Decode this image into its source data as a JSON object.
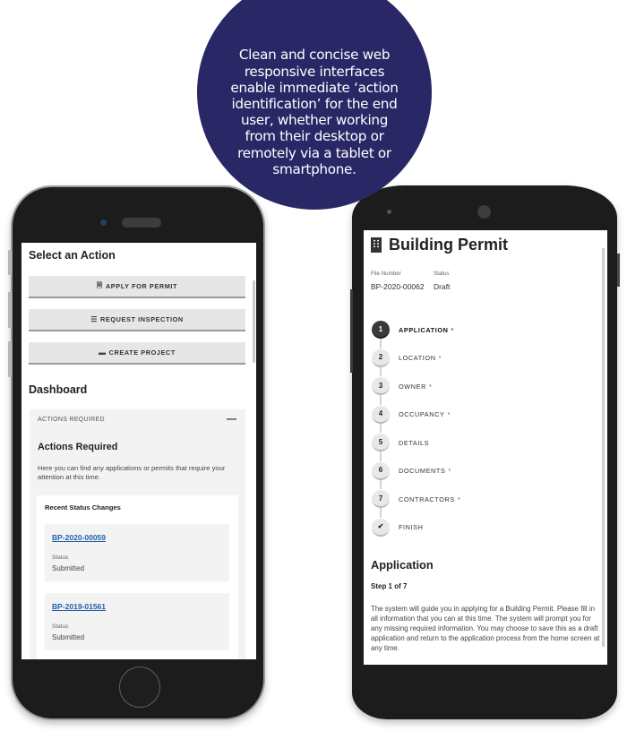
{
  "callout": {
    "text": "Clean and concise web responsive interfaces enable immediate ‘action identification’ for the end user, whether working from their desktop or remotely via a tablet or smartphone.",
    "background": "#2a2766"
  },
  "left_phone": {
    "select_action": {
      "title": "Select an Action",
      "buttons": [
        {
          "icon": "document-icon",
          "glyph": "🗎",
          "label": "APPLY FOR PERMIT"
        },
        {
          "icon": "checklist-icon",
          "glyph": "☰",
          "label": "REQUEST INSPECTION"
        },
        {
          "icon": "folder-icon",
          "glyph": "▬",
          "label": "CREATE PROJECT"
        }
      ]
    },
    "dashboard": {
      "title": "Dashboard",
      "panel": {
        "header": "ACTIONS REQUIRED",
        "collapse_glyph": "—",
        "title": "Actions Required",
        "description": "Here you can find any applications or permits that require your attention at this time.",
        "recent": {
          "title": "Recent Status Changes",
          "items": [
            {
              "file_number": "BP-2020-00059",
              "status_label": "Status",
              "status": "Submitted"
            },
            {
              "file_number": "BP-2019-01561",
              "status_label": "Status",
              "status": "Submitted"
            }
          ]
        }
      }
    },
    "link_color": "#1f5fa8"
  },
  "right_phone": {
    "title": "Building Permit",
    "file_number_label": "File Number",
    "file_number": "BP-2020-00062",
    "status_label": "Status",
    "status": "Draft",
    "steps": [
      {
        "marker": "1",
        "label": "APPLICATION",
        "required": true,
        "active": true
      },
      {
        "marker": "2",
        "label": "LOCATION",
        "required": true,
        "active": false
      },
      {
        "marker": "3",
        "label": "OWNER",
        "required": true,
        "active": false
      },
      {
        "marker": "4",
        "label": "OCCUPANCY",
        "required": true,
        "active": false
      },
      {
        "marker": "5",
        "label": "DETAILS",
        "required": false,
        "active": false
      },
      {
        "marker": "6",
        "label": "DOCUMENTS",
        "required": true,
        "active": false
      },
      {
        "marker": "7",
        "label": "CONTRACTORS",
        "required": true,
        "active": false
      },
      {
        "marker": "✔",
        "label": "FINISH",
        "required": false,
        "active": false
      }
    ],
    "required_marker": "*",
    "section_title": "Application",
    "step_indicator": "Step 1 of 7",
    "description": "The system will guide you in applying for a Building Permit. Please fill in all information that you can at this time. The system will prompt you for any missing required information. You may choose to save this as a draft application and return to the application process from the home screen at any time.",
    "required_color": "#c0392b"
  }
}
